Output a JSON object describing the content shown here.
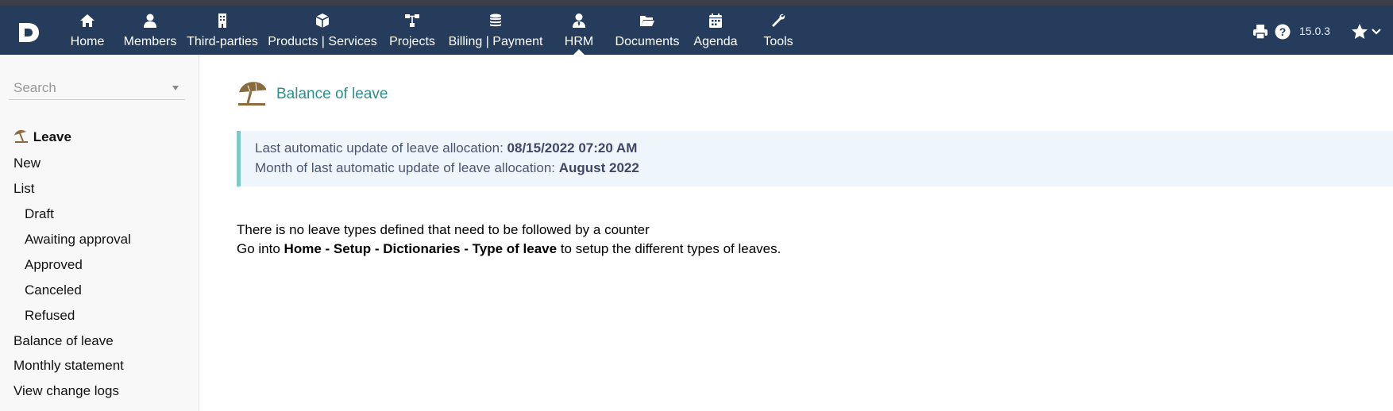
{
  "topbar": {
    "menu": [
      {
        "label": "Home",
        "icon": "home-icon"
      },
      {
        "label": "Members",
        "icon": "user-icon"
      },
      {
        "label": "Third-parties",
        "icon": "building-icon"
      },
      {
        "label": "Products | Services",
        "icon": "cube-icon"
      },
      {
        "label": "Projects",
        "icon": "sitemap-icon"
      },
      {
        "label": "Billing | Payment",
        "icon": "coins-icon"
      },
      {
        "label": "HRM",
        "icon": "user-tie-icon",
        "active": true
      },
      {
        "label": "Documents",
        "icon": "folder-open-icon"
      },
      {
        "label": "Agenda",
        "icon": "calendar-icon"
      },
      {
        "label": "Tools",
        "icon": "wrench-icon"
      }
    ],
    "version": "15.0.3",
    "colors": {
      "bar": "#263c5c",
      "accent": "#2d8f8c"
    }
  },
  "sidebar": {
    "search_placeholder": "Search",
    "section_title": "Leave",
    "items": [
      {
        "label": "New"
      },
      {
        "label": "List"
      },
      {
        "label": "Draft"
      },
      {
        "label": "Awaiting approval"
      },
      {
        "label": "Approved"
      },
      {
        "label": "Canceled"
      },
      {
        "label": "Refused"
      },
      {
        "label": "Balance of leave"
      },
      {
        "label": "Monthly statement"
      },
      {
        "label": "View change logs"
      }
    ]
  },
  "main": {
    "title": "Balance of leave",
    "info": {
      "line1_text": "Last automatic update of leave allocation: ",
      "line1_value": "08/15/2022 07:20 AM",
      "line2_text": "Month of last automatic update of leave allocation: ",
      "line2_value": "August 2022"
    },
    "message": {
      "line1": "There is no leave types defined that need to be followed by a counter",
      "line2_pre": "Go into ",
      "line2_bold": "Home - Setup - Dictionaries - Type of leave",
      "line2_post": " to setup the different types of leaves."
    }
  }
}
